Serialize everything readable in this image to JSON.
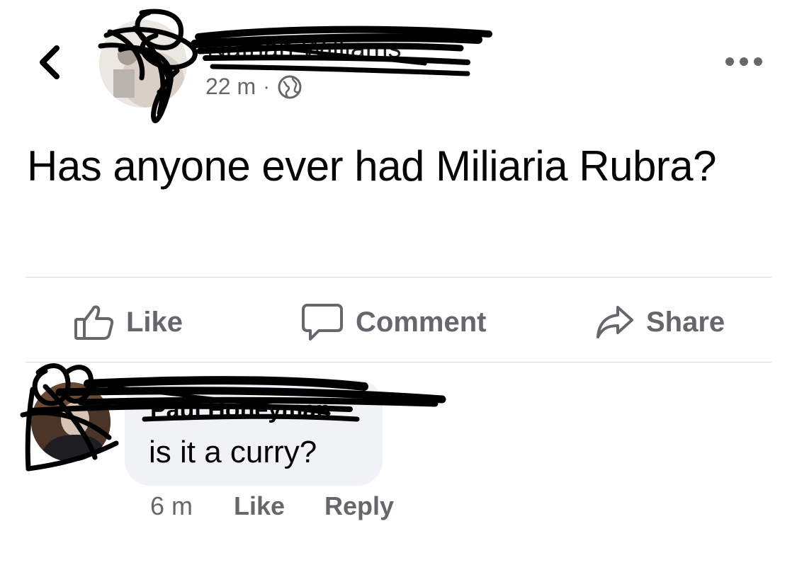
{
  "post": {
    "author_name": "Nathan Williams",
    "time": "22 m",
    "separator": "·",
    "privacy_icon": "globe-icon",
    "text": "Has anyone ever had Miliaria Rubra?",
    "back_icon": "chevron-left-icon",
    "more_icon": "more-options-icon"
  },
  "actions": {
    "like_label": "Like",
    "comment_label": "Comment",
    "share_label": "Share"
  },
  "comment": {
    "author_name": "Paul Honeyman",
    "text": "is it a curry?",
    "time": "6 m",
    "like_label": "Like",
    "reply_label": "Reply"
  },
  "colors": {
    "text_primary": "#050505",
    "text_secondary": "#65676b",
    "bubble_bg": "#f0f2f5",
    "divider": "#d7d8dc",
    "scribble": "#000000"
  }
}
